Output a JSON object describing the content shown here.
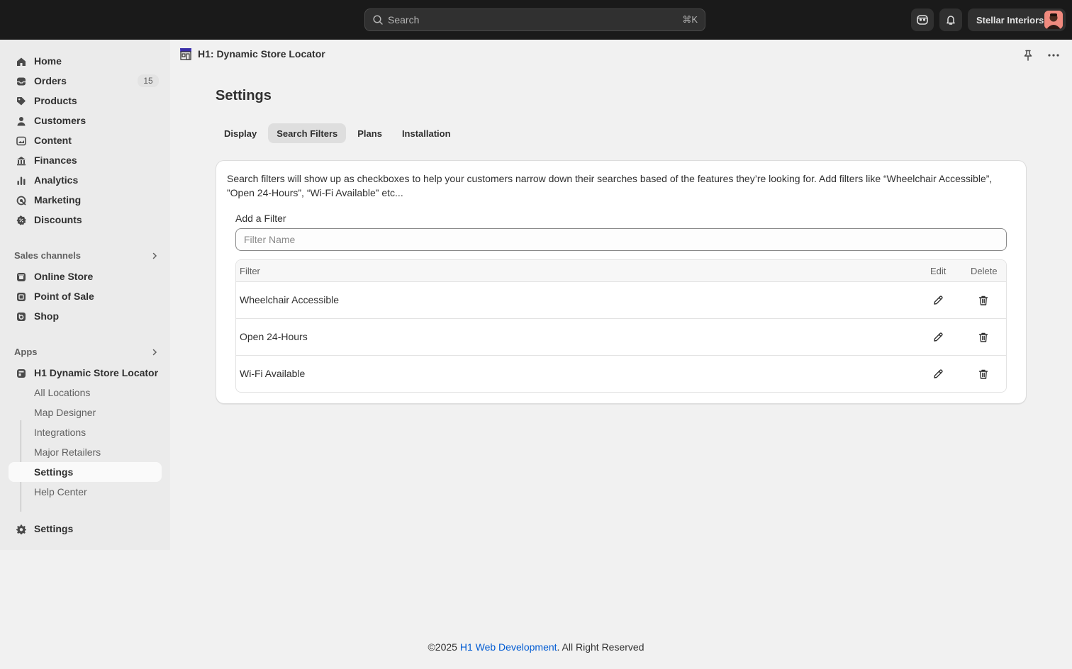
{
  "topbar": {
    "search_placeholder": "Search",
    "search_shortcut": "⌘K",
    "store_name": "Stellar Interiors"
  },
  "sidebar": {
    "main_items": [
      {
        "label": "Home",
        "icon": "home-icon"
      },
      {
        "label": "Orders",
        "icon": "inbox-icon",
        "badge": "15"
      },
      {
        "label": "Products",
        "icon": "tag-icon"
      },
      {
        "label": "Customers",
        "icon": "person-icon"
      },
      {
        "label": "Content",
        "icon": "image-icon"
      },
      {
        "label": "Finances",
        "icon": "bank-icon"
      },
      {
        "label": "Analytics",
        "icon": "bar-chart-icon"
      },
      {
        "label": "Marketing",
        "icon": "target-icon"
      },
      {
        "label": "Discounts",
        "icon": "discount-icon"
      }
    ],
    "sales_channels_label": "Sales channels",
    "sales_channels": [
      {
        "label": "Online Store",
        "icon": "store-icon"
      },
      {
        "label": "Point of Sale",
        "icon": "pos-icon"
      },
      {
        "label": "Shop",
        "icon": "shop-icon"
      }
    ],
    "apps_label": "Apps",
    "app_name": "H1 Dynamic Store Locator",
    "app_sub_items": [
      "All Locations",
      "Map Designer",
      "Integrations",
      "Major Retailers",
      "Settings",
      "Help Center"
    ],
    "settings_label": "Settings"
  },
  "page": {
    "app_title": "H1: Dynamic Store Locator",
    "title": "Settings",
    "tabs": [
      "Display",
      "Search Filters",
      "Plans",
      "Installation"
    ],
    "active_tab": "Search Filters"
  },
  "card": {
    "description": "Search filters will show up as checkboxes to help your customers narrow down their searches based of the features they’re looking for. Add filters like “Wheelchair Accessible”, ”Open 24-Hours”, “Wi-Fi Available” etc...",
    "add_label": "Add a Filter",
    "input_placeholder": "Filter Name",
    "table_headers": {
      "filter": "Filter",
      "edit": "Edit",
      "delete": "Delete"
    },
    "rows": [
      "Wheelchair Accessible",
      "Open 24-Hours",
      "Wi-Fi Available"
    ]
  },
  "footer": {
    "prefix": "©2025 ",
    "link": "H1 Web Development",
    "suffix": ". All Right Reserved"
  },
  "colors": {
    "topbar": "#1a1a1a",
    "link": "#005bd3",
    "background": "#f1f1f1"
  }
}
